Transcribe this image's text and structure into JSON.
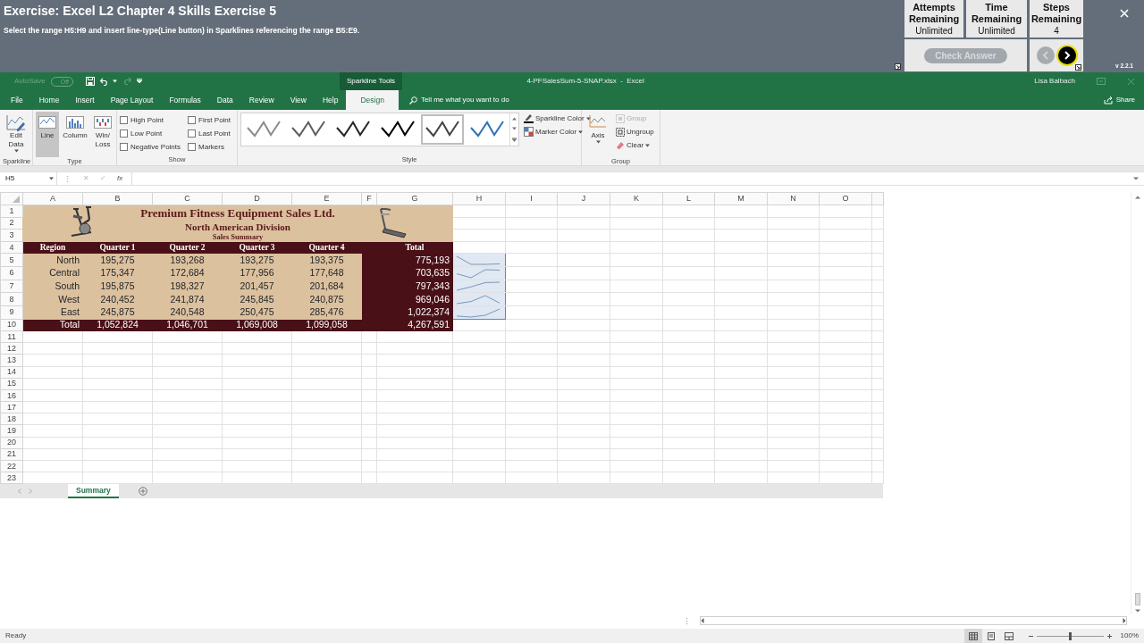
{
  "exercise": {
    "title": "Exercise: Excel L2 Chapter 4 Skills Exercise 5",
    "instruction": "Select the range H5:H9 and insert line-type(Line button) in Sparklines referencing the range B5:E9."
  },
  "counters": [
    {
      "label": "Attempts Remaining",
      "value": "Unlimited"
    },
    {
      "label": "Time Remaining",
      "value": "Unlimited"
    },
    {
      "label": "Steps Remaining",
      "value": "4"
    }
  ],
  "check_answer": {
    "label": "Check Answer",
    "disabled": true
  },
  "step_nav": [
    {
      "kind": "previous",
      "disabled": true
    },
    {
      "kind": "next",
      "disabled": false
    }
  ],
  "version": "v 2.2.1",
  "title_bar": {
    "autosave": "AutoSave",
    "autosave_state": "Off",
    "autosave_on": false,
    "context_tab": "Sparkline Tools",
    "file": "4-PFSalesSum-5-SNAP.xlsx  -  Excel",
    "user": "Lisa Balbach"
  },
  "ribbon_tabs": [
    {
      "label": "File",
      "selected": false
    },
    {
      "label": "Home",
      "selected": false
    },
    {
      "label": "Insert",
      "selected": false
    },
    {
      "label": "Page Layout",
      "selected": false
    },
    {
      "label": "Formulas",
      "selected": false
    },
    {
      "label": "Data",
      "selected": false
    },
    {
      "label": "Review",
      "selected": false
    },
    {
      "label": "View",
      "selected": false
    },
    {
      "label": "Help",
      "selected": false
    },
    {
      "label": "Design",
      "selected": true
    }
  ],
  "tell_me": "Tell me what you want to do",
  "share": "Share",
  "ribbon_groups": [
    {
      "label": "Sparkline",
      "items": [
        {
          "kind": "large",
          "label": "Edit Data",
          "dropdown": true,
          "selected": false
        }
      ]
    },
    {
      "label": "Type",
      "items": [
        {
          "kind": "large",
          "label": "Line",
          "dropdown": false,
          "selected": true
        },
        {
          "kind": "large",
          "label": "Column",
          "dropdown": false,
          "selected": false
        },
        {
          "kind": "large",
          "label": "Win/ Loss",
          "dropdown": false,
          "selected": false
        }
      ]
    },
    {
      "label": "Show",
      "items": [
        {
          "kind": "checkbox",
          "label": "High Point",
          "checked": false
        },
        {
          "kind": "checkbox",
          "label": "Low Point",
          "checked": false
        },
        {
          "kind": "checkbox",
          "label": "Negative Points",
          "checked": false
        },
        {
          "kind": "checkbox",
          "label": "First Point",
          "checked": false
        },
        {
          "kind": "checkbox",
          "label": "Last Point",
          "checked": false
        },
        {
          "kind": "checkbox",
          "label": "Markers",
          "checked": false
        }
      ]
    },
    {
      "label": "Style",
      "items": [
        {
          "kind": "gallery",
          "styles": [
            {
              "color": "#8c8c8c",
              "selected": false
            },
            {
              "color": "#5f5f5f",
              "selected": false
            },
            {
              "color": "#262626",
              "selected": false
            },
            {
              "color": "#000000",
              "selected": false
            },
            {
              "color": "#444444",
              "selected": true
            },
            {
              "color": "#2e75b6",
              "selected": false
            }
          ]
        },
        {
          "kind": "small",
          "label": "Sparkline Color",
          "dropdown": true
        },
        {
          "kind": "small",
          "label": "Marker Color",
          "dropdown": true
        }
      ]
    },
    {
      "label": "Group",
      "items": [
        {
          "kind": "large",
          "label": "Axis",
          "dropdown": true,
          "selected": false,
          "disabled": false
        },
        {
          "kind": "small",
          "label": "Group",
          "dropdown": false,
          "disabled": true
        },
        {
          "kind": "small",
          "label": "Ungroup",
          "dropdown": false,
          "disabled": false
        },
        {
          "kind": "small",
          "label": "Clear",
          "dropdown": true,
          "disabled": false
        }
      ]
    }
  ],
  "formula_bar": {
    "name_box": "H5",
    "cancel": "✕",
    "enter": "✓",
    "function": "fx"
  },
  "sheet": {
    "columns": [
      "A",
      "B",
      "C",
      "D",
      "E",
      "F",
      "G",
      "H",
      "I",
      "J",
      "K",
      "L",
      "M",
      "N",
      "O"
    ],
    "rows": [
      "1",
      "2",
      "3",
      "4",
      "5",
      "6",
      "7",
      "8",
      "9",
      "10",
      "11",
      "12",
      "13",
      "14",
      "15",
      "16",
      "17",
      "18",
      "19",
      "20",
      "21",
      "22",
      "23"
    ]
  },
  "report": {
    "title": "Premium Fitness Equipment Sales Ltd.",
    "subtitle": "North American Division",
    "caption": "Sales Summary",
    "headers": [
      "Region",
      "Quarter 1",
      "Quarter 2",
      "Quarter 3",
      "Quarter 4",
      "Total"
    ],
    "rows": [
      {
        "region": "North",
        "values": [
          "195,275",
          "193,268",
          "193,275",
          "193,375"
        ],
        "total": "775,193"
      },
      {
        "region": "Central",
        "values": [
          "175,347",
          "172,684",
          "177,956",
          "177,648"
        ],
        "total": "703,635"
      },
      {
        "region": "South",
        "values": [
          "195,875",
          "198,327",
          "201,457",
          "201,684"
        ],
        "total": "797,343"
      },
      {
        "region": "West",
        "values": [
          "240,452",
          "241,874",
          "245,845",
          "240,875"
        ],
        "total": "969,046"
      },
      {
        "region": "East",
        "values": [
          "245,875",
          "240,548",
          "250,475",
          "285,476"
        ],
        "total": "1,022,374"
      }
    ],
    "total_row": {
      "label": "Total",
      "values": [
        "1,052,824",
        "1,046,701",
        "1,069,008",
        "1,099,058"
      ],
      "total": "4,267,591"
    }
  },
  "sparklines": {
    "selected": true
  },
  "sheet_tabs": [
    {
      "label": "Summary",
      "selected": true
    }
  ],
  "status": "Ready",
  "view_buttons": [
    {
      "selected": true
    },
    {
      "selected": false
    },
    {
      "selected": false
    }
  ],
  "zoom": {
    "level": 0.5,
    "label": "100%"
  }
}
